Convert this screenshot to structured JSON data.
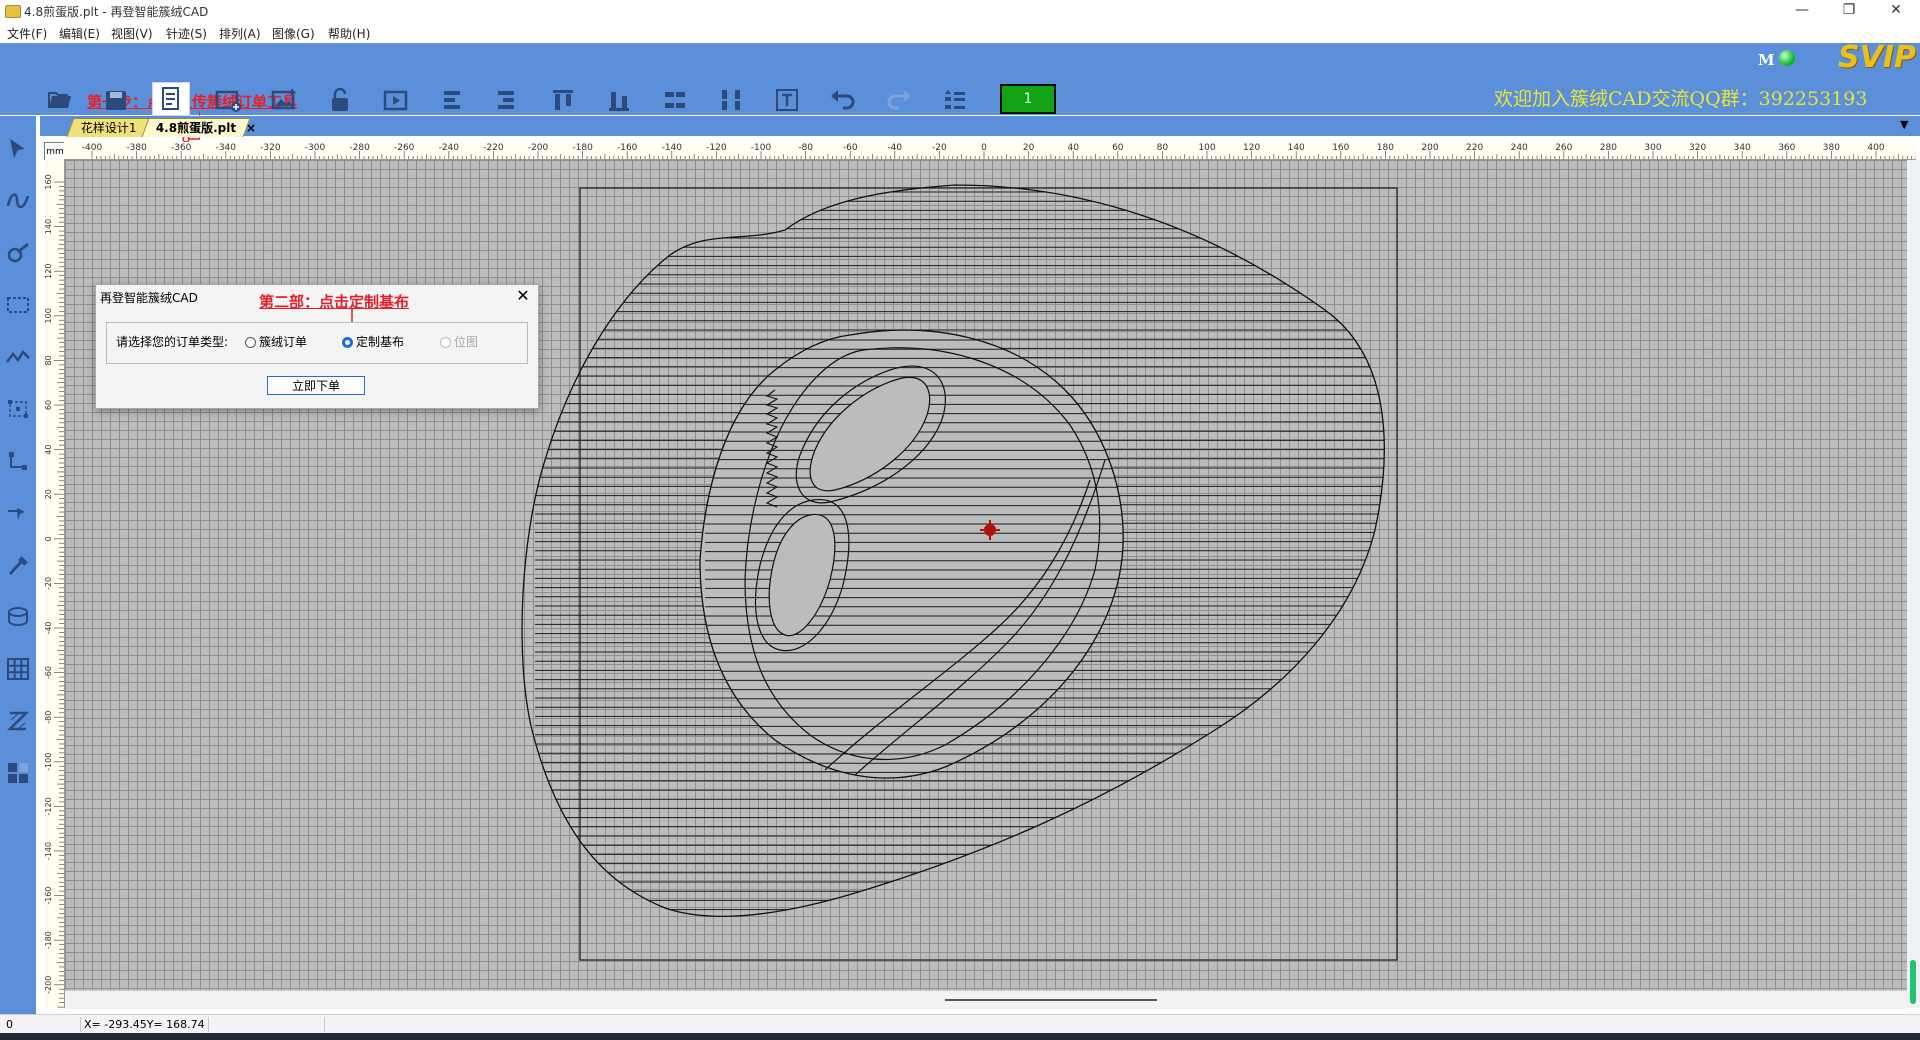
{
  "window": {
    "title": "4.8煎蛋版.plt - 再登智能簇绒CAD",
    "controls": {
      "minimize": "—",
      "maximize": "❐",
      "close": "✕"
    }
  },
  "menu": [
    {
      "label": "文件(F)"
    },
    {
      "label": "编辑(E)"
    },
    {
      "label": "视图(V)"
    },
    {
      "label": "针迹(S)"
    },
    {
      "label": "排列(A)"
    },
    {
      "label": "图像(G)"
    },
    {
      "label": "帮助(H)"
    }
  ],
  "toolbar": {
    "annotation_step1": "第一步：点击上传簇绒订单工具",
    "counter_value": "1",
    "welcome_text": "欢迎加入簇绒CAD交流QQ群：392253193",
    "status_letter": "M",
    "badge_text": "SVIP",
    "colors": {
      "toolbar_bg": "#5b8fd9",
      "welcome": "#e6e63a",
      "annotation": "#e3202a",
      "counter": "#14a314"
    }
  },
  "tabs": [
    {
      "label": "花样设计1"
    },
    {
      "label": "4.8煎蛋版.plt",
      "active": true,
      "close": "×"
    }
  ],
  "tab_dropdown": "▼",
  "ruler": {
    "unit": "mm",
    "h_ticks": [
      "-400",
      "-380",
      "-360",
      "-340",
      "-320",
      "-300",
      "-280",
      "-260",
      "-240",
      "-220",
      "-200",
      "-180",
      "-160",
      "-140",
      "-120",
      "-100",
      "-80",
      "-60",
      "-40",
      "-20",
      "0",
      "20",
      "40",
      "60",
      "80",
      "100",
      "120",
      "140",
      "160",
      "180",
      "200",
      "220",
      "240",
      "260",
      "280",
      "300",
      "320",
      "340",
      "360",
      "380",
      "400"
    ],
    "v_ticks": [
      "160",
      "140",
      "120",
      "100",
      "80",
      "60",
      "40",
      "20",
      "0",
      "-20",
      "-40",
      "-60",
      "-80",
      "-100",
      "-120",
      "-140",
      "-160",
      "-180",
      "-200"
    ]
  },
  "dialog": {
    "title": "再登智能簇绒CAD",
    "annotation_step2": "第二部：点击定制基布",
    "prompt": "请选择您的订单类型:",
    "options": [
      {
        "label": "簇绒订单",
        "selected": false,
        "disabled": false
      },
      {
        "label": "定制基布",
        "selected": true,
        "disabled": false
      },
      {
        "label": "位图",
        "selected": false,
        "disabled": true
      }
    ],
    "submit_label": "立即下单",
    "close": "✕"
  },
  "status_bar": {
    "left_value": "0",
    "coordinates": "X= -293.45Y= 168.74"
  }
}
